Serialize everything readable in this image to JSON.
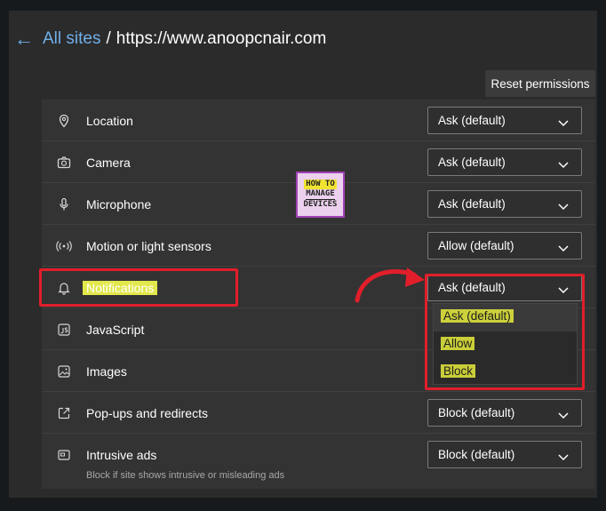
{
  "header": {
    "back_label": "←",
    "parent": "All sites",
    "separator": "/",
    "site": "https://www.anoopcnair.com"
  },
  "reset_button": "Reset permissions",
  "permissions": [
    {
      "label": "Location",
      "icon": "location-pin-icon",
      "value": "Ask (default)"
    },
    {
      "label": "Camera",
      "icon": "camera-icon",
      "value": "Ask (default)"
    },
    {
      "label": "Microphone",
      "icon": "microphone-icon",
      "value": "Ask (default)"
    },
    {
      "label": "Motion or light sensors",
      "icon": "motion-sensor-icon",
      "value": "Allow (default)"
    },
    {
      "label": "Notifications",
      "icon": "bell-icon",
      "value": "Ask (default)"
    },
    {
      "label": "JavaScript",
      "icon": "javascript-icon",
      "value": ""
    },
    {
      "label": "Images",
      "icon": "image-icon",
      "value": ""
    },
    {
      "label": "Pop-ups and redirects",
      "icon": "popup-icon",
      "value": "Block (default)"
    },
    {
      "label": "Intrusive ads",
      "icon": "ads-icon",
      "value": "Block (default)",
      "sub": "Block if site shows intrusive or misleading ads"
    }
  ],
  "dropdown_options": [
    "Ask (default)",
    "Allow",
    "Block"
  ],
  "logo": {
    "line1": "HOW TO",
    "line2": "MANAGE",
    "line3": "DEVICES"
  },
  "colors": {
    "link": "#6fb0ea",
    "highlight": "#e2e74c",
    "annotation": "#e11e2a"
  }
}
